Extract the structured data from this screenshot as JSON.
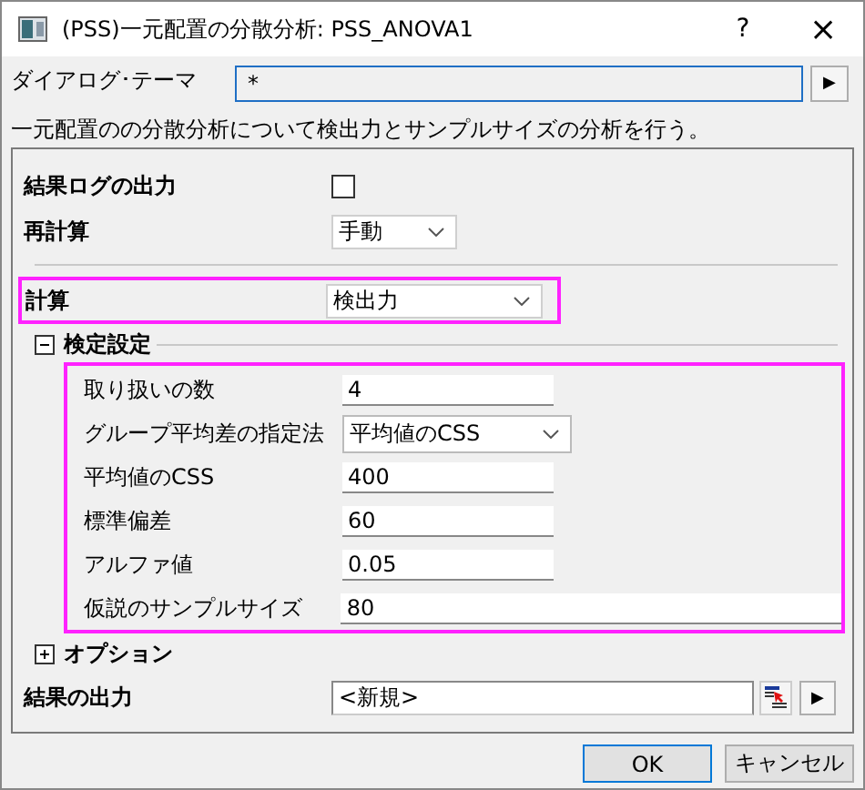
{
  "window": {
    "title": "(PSS)一元配置の分散分析: PSS_ANOVA1",
    "help": "?",
    "close": "×"
  },
  "theme": {
    "label": "ダイアログ･テーマ",
    "value": "*",
    "button": "▶"
  },
  "description": "一元配置のの分散分析について検出力とサンプルサイズの分析を行う。",
  "rows": [
    {
      "kind": "checkbox",
      "label": "結果ログの出力",
      "checked": false,
      "highlighted": false
    },
    {
      "kind": "combo",
      "label": "再計算",
      "value": "手動",
      "highlighted": false
    },
    {
      "kind": "combo",
      "label": "計算",
      "value": "検出力",
      "highlighted": true
    }
  ],
  "sections": [
    {
      "label": "検定設定",
      "expanded": true,
      "highlighted": true,
      "rows": [
        {
          "kind": "text",
          "label": "取り扱いの数",
          "value": "4"
        },
        {
          "kind": "combo",
          "label": "グループ平均差の指定法",
          "value": "平均値のCSS"
        },
        {
          "kind": "text",
          "label": "平均値のCSS",
          "value": "400"
        },
        {
          "kind": "text",
          "label": "標準偏差",
          "value": "60"
        },
        {
          "kind": "text",
          "label": "アルファ値",
          "value": "0.05"
        },
        {
          "kind": "text",
          "label": "仮説のサンプルサイズ",
          "value": "80"
        }
      ]
    },
    {
      "label": "オプション",
      "expanded": false
    }
  ],
  "output": {
    "label": "結果の出力",
    "value": "<新規>",
    "button": "▶"
  },
  "buttons": [
    {
      "label": "OK",
      "default": true
    },
    {
      "label": "キャンセル",
      "default": false
    }
  ]
}
